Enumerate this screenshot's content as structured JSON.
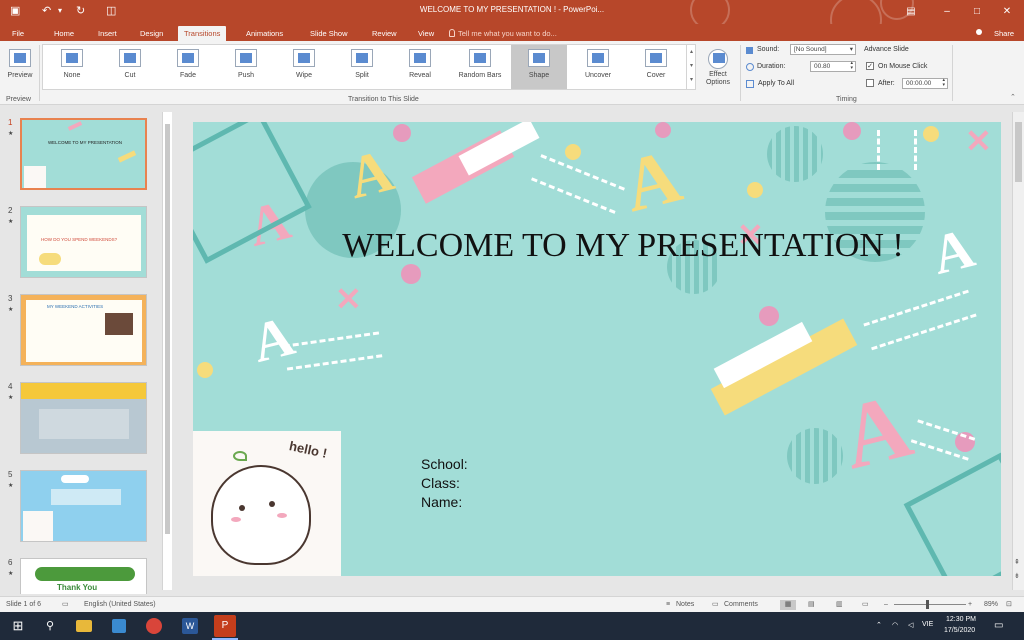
{
  "window": {
    "title": "WELCOME TO MY PRESENTATION ! - PowerPoi..."
  },
  "quick_access": {
    "save_glyph": "▣",
    "undo_glyph": "↶",
    "undo_dropdown_glyph": "▾",
    "redo_glyph": "↻",
    "slideshow_glyph": "◫"
  },
  "window_controls": {
    "ribbon_options_glyph": "▤",
    "minimize_glyph": "–",
    "maximize_glyph": "□",
    "close_glyph": "✕"
  },
  "tabs": [
    {
      "label": "File"
    },
    {
      "label": "Home"
    },
    {
      "label": "Insert"
    },
    {
      "label": "Design"
    },
    {
      "label": "Transitions"
    },
    {
      "label": "Animations"
    },
    {
      "label": "Slide Show"
    },
    {
      "label": "Review"
    },
    {
      "label": "View"
    }
  ],
  "active_tab": "Transitions",
  "tell_me": {
    "text": "Tell me what you want to do..."
  },
  "share": {
    "label": "Share"
  },
  "ribbon": {
    "preview_label": "Preview",
    "preview_group": "Preview",
    "transitions": [
      {
        "label": "None"
      },
      {
        "label": "Cut"
      },
      {
        "label": "Fade"
      },
      {
        "label": "Push"
      },
      {
        "label": "Wipe"
      },
      {
        "label": "Split"
      },
      {
        "label": "Reveal"
      },
      {
        "label": "Random Bars"
      },
      {
        "label": "Shape"
      },
      {
        "label": "Uncover"
      },
      {
        "label": "Cover"
      }
    ],
    "selected_transition": "Shape",
    "effect_options_label": "Effect Options",
    "transition_group": "Transition to This Slide",
    "timing": {
      "sound_label": "Sound:",
      "sound_value": "[No Sound]",
      "duration_label": "Duration:",
      "duration_value": "00.80",
      "apply_all_label": "Apply To All",
      "advance_label": "Advance Slide",
      "on_click_label": "On Mouse Click",
      "on_click_checked": true,
      "after_label": "After:",
      "after_checked": false,
      "after_value": "00:00.00",
      "group": "Timing"
    }
  },
  "slides": [
    {
      "number": "1",
      "thumb_text": "WELCOME TO MY PRESENTATION"
    },
    {
      "number": "2",
      "thumb_text": "HOW DO YOU SPEND WEEKENDS?"
    },
    {
      "number": "3",
      "thumb_text": "MY WEEKEND ACTIVITIES"
    },
    {
      "number": "4",
      "thumb_text": ""
    },
    {
      "number": "5",
      "thumb_text": ""
    },
    {
      "number": "6",
      "thumb_text": "Thank You"
    }
  ],
  "selected_slide": 1,
  "slide": {
    "title": "WELCOME TO MY PRESENTATION !",
    "school_label": "School:",
    "class_label": "Class:",
    "name_label": "Name:",
    "hello_text": "hello !"
  },
  "status": {
    "slide_of": "Slide 1 of 6",
    "language": "English (United States)",
    "notes": "Notes",
    "comments": "Comments",
    "zoom": "89%"
  },
  "taskbar": {
    "lang": "VIE",
    "time": "12:30 PM",
    "date": "17/5/2020"
  },
  "colors": {
    "accent": "#b7472a",
    "slide_bg": "#a2ddd7",
    "pink": "#f3a8bd",
    "yellow": "#f6dc7c",
    "teal": "#5fb8b0"
  }
}
